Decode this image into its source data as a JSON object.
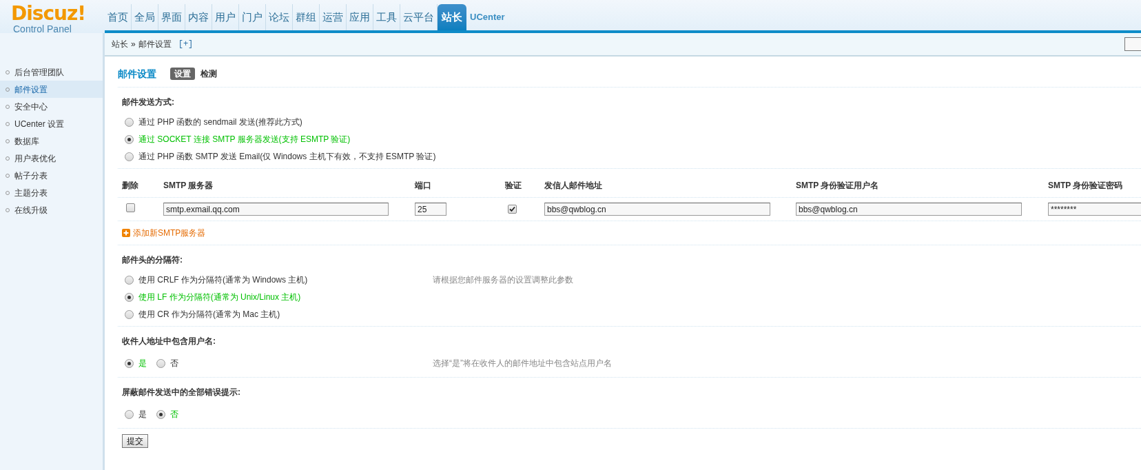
{
  "logo": {
    "name": "Discuz!",
    "subtitle": "Control Panel"
  },
  "nav": [
    {
      "label": "首页",
      "selected": false
    },
    {
      "label": "全局",
      "selected": false
    },
    {
      "label": "界面",
      "selected": false
    },
    {
      "label": "内容",
      "selected": false
    },
    {
      "label": "用户",
      "selected": false
    },
    {
      "label": "门户",
      "selected": false
    },
    {
      "label": "论坛",
      "selected": false
    },
    {
      "label": "群组",
      "selected": false
    },
    {
      "label": "运营",
      "selected": false
    },
    {
      "label": "应用",
      "selected": false
    },
    {
      "label": "工具",
      "selected": false
    },
    {
      "label": "云平台",
      "selected": false
    },
    {
      "label": "站长",
      "selected": true
    },
    {
      "label": "UCenter",
      "selected": false
    }
  ],
  "breadcrumb": {
    "path": [
      "站长",
      "邮件设置"
    ],
    "separator": "»",
    "add": "[+]"
  },
  "sidebar": {
    "items": [
      {
        "label": "后台管理团队",
        "selected": false
      },
      {
        "label": "邮件设置",
        "selected": true
      },
      {
        "label": "安全中心",
        "selected": false
      },
      {
        "label": "UCenter 设置",
        "selected": false
      },
      {
        "label": "数据库",
        "selected": false
      },
      {
        "label": "用户表优化",
        "selected": false
      },
      {
        "label": "帖子分表",
        "selected": false
      },
      {
        "label": "主题分表",
        "selected": false
      },
      {
        "label": "在线升级",
        "selected": false
      }
    ]
  },
  "page": {
    "title": "邮件设置",
    "tabs": [
      {
        "label": "设置",
        "selected": true
      },
      {
        "label": "检测",
        "selected": false
      }
    ]
  },
  "sections": [
    {
      "kind": "radio",
      "title": "邮件发送方式:",
      "options": [
        {
          "label": "通过 PHP 函数的 sendmail 发送(推荐此方式)",
          "selected": false
        },
        {
          "label": "通过 SOCKET 连接 SMTP 服务器发送(支持 ESMTP 验证)",
          "selected": true
        },
        {
          "label": "通过 PHP 函数 SMTP 发送 Email(仅 Windows 主机下有效，不支持 ESMTP 验证)",
          "selected": false
        }
      ]
    },
    {
      "kind": "smtp_table",
      "columns": [
        "删除",
        "SMTP 服务器",
        "端口",
        "验证",
        "发信人邮件地址",
        "SMTP 身份验证用户名",
        "SMTP 身份验证密码"
      ],
      "rows": [
        {
          "delete": false,
          "server": "smtp.exmail.qq.com",
          "port": "25",
          "auth": true,
          "from": "bbs@qwblog.cn",
          "username": "bbs@qwblog.cn",
          "password": "********"
        }
      ],
      "add_link": "添加新SMTP服务器"
    },
    {
      "kind": "radio",
      "title": "邮件头的分隔符:",
      "hint": "请根据您邮件服务器的设置调整此参数",
      "options": [
        {
          "label": "使用 CRLF 作为分隔符(通常为 Windows 主机)",
          "selected": false
        },
        {
          "label": "使用 LF 作为分隔符(通常为 Unix/Linux 主机)",
          "selected": true
        },
        {
          "label": "使用 CR 作为分隔符(通常为 Mac 主机)",
          "selected": false
        }
      ]
    },
    {
      "kind": "radio_inline",
      "title": "收件人地址中包含用户名:",
      "hint": "选择“是”将在收件人的邮件地址中包含站点用户名",
      "options": [
        {
          "label": "是",
          "selected": true
        },
        {
          "label": "否",
          "selected": false
        }
      ]
    },
    {
      "kind": "radio_inline",
      "title": "屏蔽邮件发送中的全部错误提示:",
      "options": [
        {
          "label": "是",
          "selected": false
        },
        {
          "label": "否",
          "selected": true
        }
      ]
    }
  ],
  "submit": "提交"
}
